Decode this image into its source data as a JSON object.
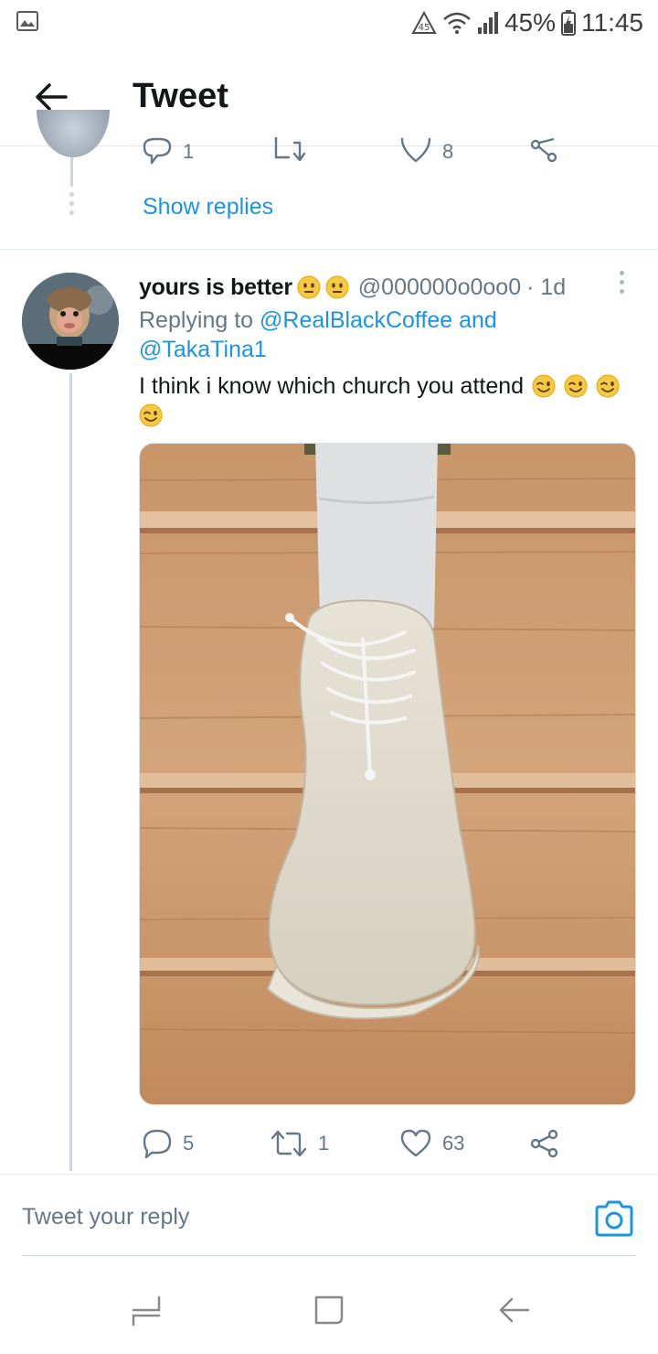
{
  "status_bar": {
    "battery": "45%",
    "time": "11:45",
    "icons": [
      "gallery-icon",
      "data-saver-icon",
      "wifi-icon",
      "signal-icon",
      "battery-icon"
    ]
  },
  "header": {
    "title": "Tweet",
    "back_icon": "arrow-left-icon"
  },
  "previous_tweet": {
    "reply_count": "1",
    "retweet_count": "",
    "like_count": "8",
    "show_replies_label": "Show replies"
  },
  "tweet": {
    "display_name": "yours is better",
    "name_emojis": [
      "neutral-face",
      "neutral-face"
    ],
    "handle": "@000000o0oo0",
    "time_ago": "· 1d",
    "replying_prefix": "Replying to",
    "replying_mention_1": "@RealBlackCoffee",
    "replying_and": "and",
    "replying_mention_2": "@TakaTina1",
    "text": "I think i know which church you attend",
    "text_emojis": [
      "winking-face",
      "winking-face",
      "winking-face",
      "winking-face"
    ],
    "media_description": "white suede shoe with white sock on wooden steps",
    "actions": {
      "reply_count": "5",
      "retweet_count": "1",
      "like_count": "63"
    }
  },
  "composer": {
    "placeholder": "Tweet your reply"
  },
  "colors": {
    "accent": "#1b95e0",
    "secondary_text": "#657786",
    "primary_text": "#14171a",
    "divider": "#e1e8ed"
  }
}
